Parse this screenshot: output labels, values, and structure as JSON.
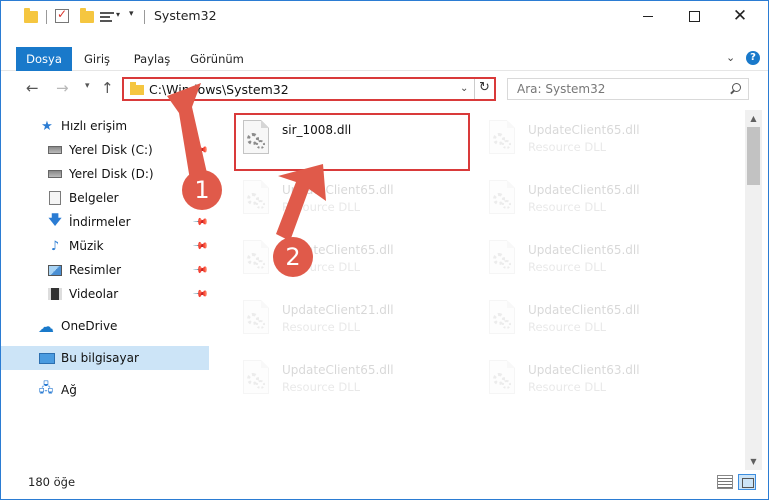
{
  "window": {
    "title": "System32"
  },
  "ribbon": {
    "tabs": [
      "Dosya",
      "Giriş",
      "Paylaş",
      "Görünüm"
    ]
  },
  "address_bar": {
    "path": "C:\\Windows\\System32"
  },
  "search": {
    "placeholder": "Ara: System32"
  },
  "sidebar": {
    "items": [
      {
        "label": "Hızlı erişim",
        "icon": "star-icon",
        "pinned": false
      },
      {
        "label": "Yerel Disk (C:)",
        "icon": "drive-icon",
        "pinned": true
      },
      {
        "label": "Yerel Disk (D:)",
        "icon": "drive-icon",
        "pinned": false
      },
      {
        "label": "Belgeler",
        "icon": "documents-icon",
        "pinned": true
      },
      {
        "label": "İndirmeler",
        "icon": "download-icon",
        "pinned": true
      },
      {
        "label": "Müzik",
        "icon": "music-icon",
        "pinned": true
      },
      {
        "label": "Resimler",
        "icon": "pictures-icon",
        "pinned": true
      },
      {
        "label": "Videolar",
        "icon": "videos-icon",
        "pinned": true
      },
      {
        "label": "OneDrive",
        "icon": "cloud-icon",
        "pinned": false
      },
      {
        "label": "Bu bilgisayar",
        "icon": "computer-icon",
        "pinned": false,
        "selected": true
      },
      {
        "label": "Ağ",
        "icon": "network-icon",
        "pinned": false
      }
    ]
  },
  "files": [
    {
      "name": "sir_1008.dll",
      "type": "",
      "highlighted": true
    },
    {
      "name": "UpdateClient65.dll",
      "type": "Resource DLL"
    },
    {
      "name": "UpdateClient65.dll",
      "type": "Resource DLL"
    },
    {
      "name": "UpdateClient65.dll",
      "type": "Resource DLL"
    },
    {
      "name": "UpdateClient65.dll",
      "type": "Resource DLL"
    },
    {
      "name": "UpdateClient65.dll",
      "type": "Resource DLL"
    },
    {
      "name": "UpdateClient21.dll",
      "type": "Resource DLL"
    },
    {
      "name": "UpdateClient65.dll",
      "type": "Resource DLL"
    },
    {
      "name": "UpdateClient65.dll",
      "type": "Resource DLL"
    },
    {
      "name": "UpdateClient63.dll",
      "type": "Resource DLL"
    }
  ],
  "annotations": {
    "step1": "1",
    "step2": "2",
    "color": "#e05a4a",
    "box_color": "#d93a3a"
  },
  "status": {
    "count": "180 öğe"
  },
  "colors": {
    "accent": "#1979ca",
    "selection": "#cce4f7"
  }
}
